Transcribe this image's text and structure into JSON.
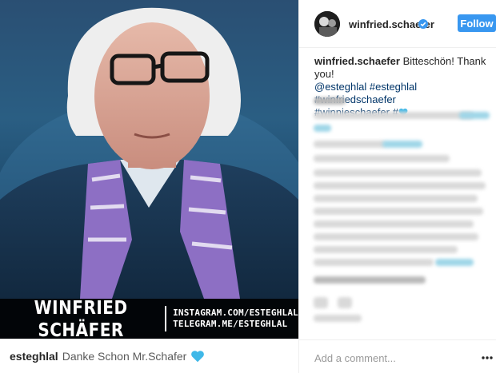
{
  "photo": {
    "banner_name": "WINFRIED SCHÄFER",
    "banner_link_1": "INSTAGRAM.COM/ESTEGHLAL",
    "banner_link_2": "TELEGRAM.ME/ESTEGHLAL"
  },
  "left_comment": {
    "username": "esteghlal",
    "text": "Danke Schon Mr.Schafer",
    "icon": "blue-heart-icon"
  },
  "header": {
    "username": "winfried.schaefer",
    "verified": true,
    "follow_label": "Follow"
  },
  "caption": {
    "username": "winfried.schaefer",
    "text": "Bitteschön! Thank you!",
    "tags": [
      "@esteghlal",
      "#esteghlal",
      "#winfriedschaefer",
      "#winnieschaefer",
      "#"
    ],
    "icon": "blue-heart-icon"
  },
  "comment_box": {
    "placeholder": "Add a comment...",
    "more_icon": "more-options-icon"
  },
  "colors": {
    "follow_button": "#3897f0",
    "link": "#003569",
    "heart": "#3fb8e8"
  }
}
